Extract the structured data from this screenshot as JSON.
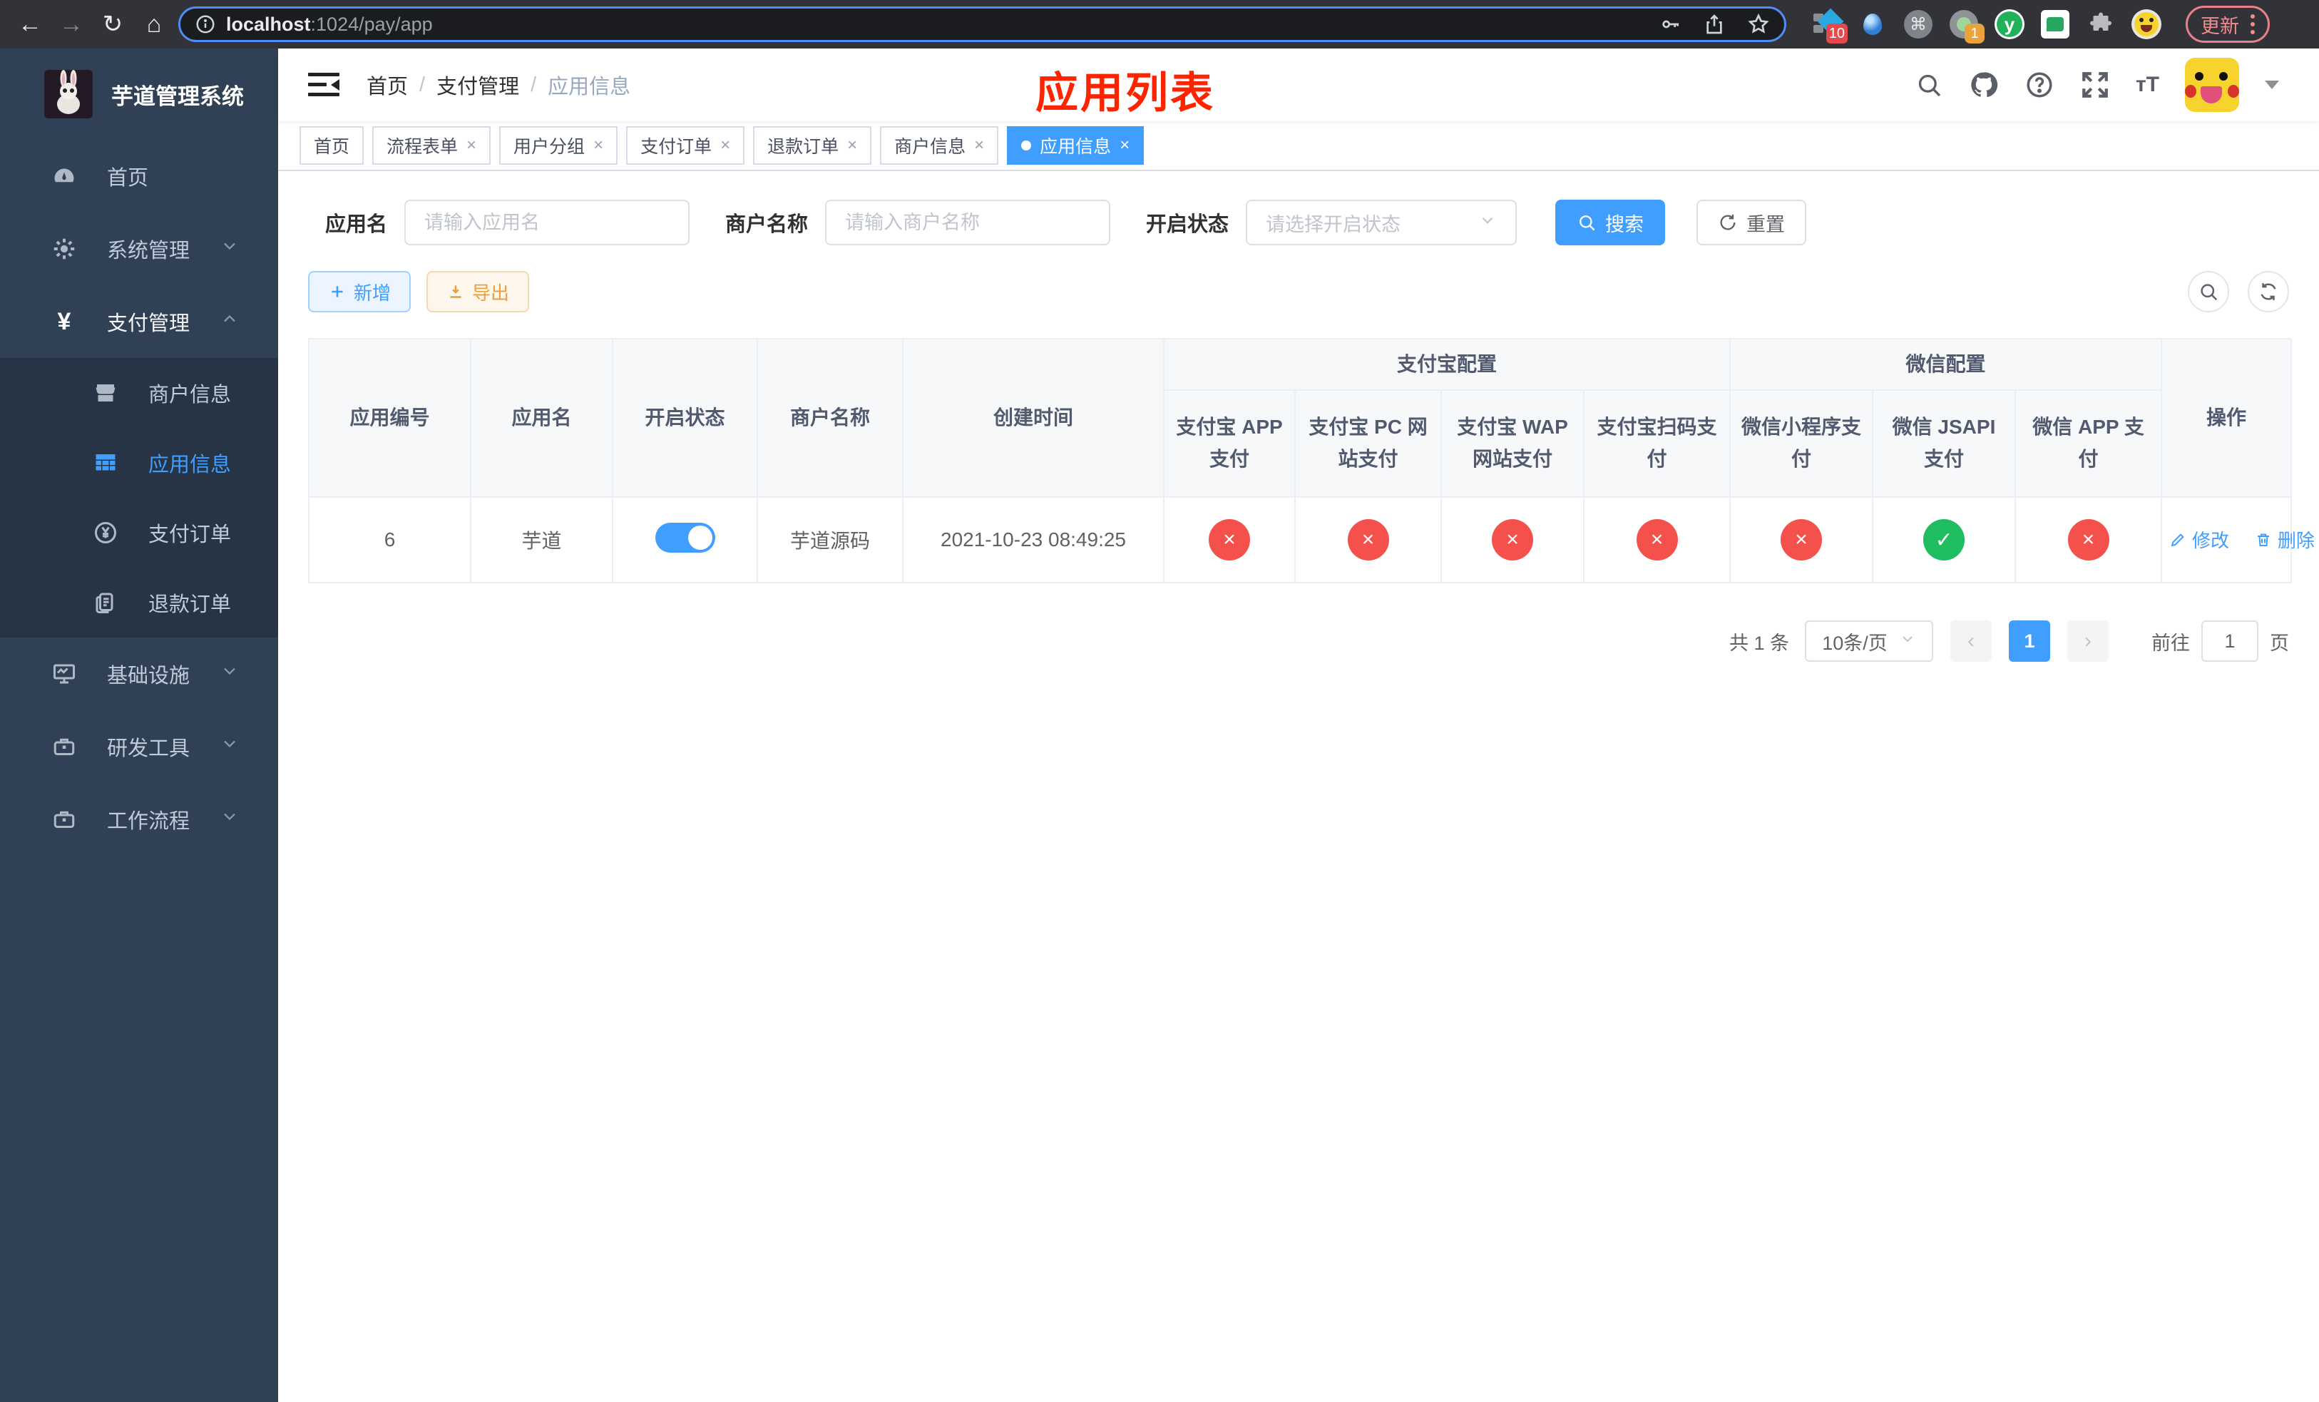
{
  "browser": {
    "url_host": "localhost",
    "url_rest": ":1024/pay/app",
    "update_label": "更新",
    "extension_badge_10": "10",
    "extension_badge_1": "1"
  },
  "sidebar": {
    "title": "芋道管理系统",
    "items": [
      {
        "label": "首页"
      },
      {
        "label": "系统管理"
      },
      {
        "label": "支付管理"
      },
      {
        "label": "基础设施"
      },
      {
        "label": "研发工具"
      },
      {
        "label": "工作流程"
      }
    ],
    "submenu": [
      {
        "label": "商户信息"
      },
      {
        "label": "应用信息"
      },
      {
        "label": "支付订单"
      },
      {
        "label": "退款订单"
      }
    ]
  },
  "navbar": {
    "breadcrumb": [
      "首页",
      "支付管理",
      "应用信息"
    ],
    "separator": "/"
  },
  "annotation": {
    "title": "应用列表"
  },
  "tabs": [
    {
      "label": "首页"
    },
    {
      "label": "流程表单"
    },
    {
      "label": "用户分组"
    },
    {
      "label": "支付订单"
    },
    {
      "label": "退款订单"
    },
    {
      "label": "商户信息"
    },
    {
      "label": "应用信息"
    }
  ],
  "filters": {
    "name_label": "应用名",
    "name_placeholder": "请输入应用名",
    "merchant_label": "商户名称",
    "merchant_placeholder": "请输入商户名称",
    "status_label": "开启状态",
    "status_placeholder": "请选择开启状态",
    "search_label": "搜索",
    "reset_label": "重置"
  },
  "toolbar": {
    "add_label": "新增",
    "export_label": "导出"
  },
  "table": {
    "columns": [
      "应用编号",
      "应用名",
      "开启状态",
      "商户名称",
      "创建时间"
    ],
    "groups": [
      {
        "label": "支付宝配置",
        "children": [
          "支付宝 APP 支付",
          "支付宝 PC 网站支付",
          "支付宝 WAP 网站支付",
          "支付宝扫码支付"
        ]
      },
      {
        "label": "微信配置",
        "children": [
          "微信小程序支付",
          "微信 JSAPI 支付",
          "微信 APP 支付"
        ]
      }
    ],
    "actions_label": "操作",
    "row": {
      "id": "6",
      "name": "芋道",
      "enabled": true,
      "merchant": "芋道源码",
      "created_at": "2021-10-23 08:49:25",
      "channels": [
        false,
        false,
        false,
        false,
        false,
        true,
        false
      ],
      "edit_label": "修改",
      "delete_label": "删除"
    }
  },
  "pagination": {
    "total": "共 1 条",
    "page_size": "10条/页",
    "current_page": "1",
    "goto_label": "前往",
    "goto_value": "1",
    "page_unit": "页"
  },
  "colors": {
    "primary": "#409EFF",
    "success": "#1dbd60",
    "danger": "#f4514c",
    "warning": "#e6a23c",
    "annotation": "#ff2400",
    "sidebar_bg": "#304156",
    "submenu_bg": "#263445"
  }
}
